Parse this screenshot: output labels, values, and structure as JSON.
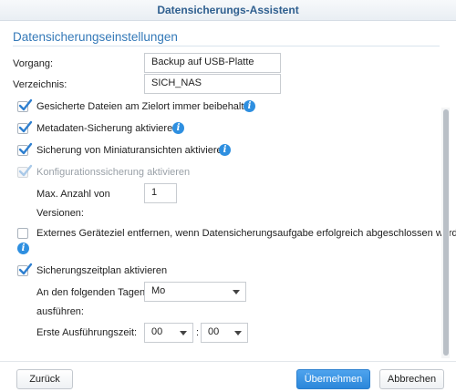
{
  "window": {
    "title": "Datensicherungs-Assistent"
  },
  "section": {
    "title": "Datensicherungseinstellungen"
  },
  "fields": {
    "vorgang_label": "Vorgang:",
    "vorgang_value": "Backup auf USB-Platte",
    "verzeichnis_label": "Verzeichnis:",
    "verzeichnis_value": "SICH_NAS"
  },
  "options": [
    {
      "label": "Gesicherte Dateien am Zielort immer beibehalten",
      "checked": true,
      "info": true
    },
    {
      "label": "Metadaten-Sicherung aktivieren",
      "checked": true,
      "info": true
    },
    {
      "label": "Sicherung von Miniaturansichten aktivieren",
      "checked": true,
      "info": true
    },
    {
      "label": "Konfigurationssicherung aktivieren",
      "checked": true,
      "disabled": true
    },
    {
      "label": "Externes Geräteziel entfernen, wenn Datensicherungsaufgabe erfolgreich abgeschlossen wurde.",
      "checked": false,
      "info": true
    },
    {
      "label": "Sicherungszeitplan aktivieren",
      "checked": true
    }
  ],
  "versions": {
    "label_line1": "Max. Anzahl von",
    "label_line2": "Versionen:",
    "value": "1"
  },
  "schedule": {
    "days_label_line1": "An den folgenden Tagen",
    "days_label_line2": "ausführen:",
    "days_value": "Mo",
    "time_label": "Erste Ausführungszeit:",
    "hour_value": "00",
    "separator": ":",
    "minute_value": "00"
  },
  "buttons": {
    "back": "Zurück",
    "apply": "Übernehmen",
    "cancel": "Abbrechen"
  },
  "colors": {
    "accent": "#3479b8",
    "primary_button": "#2b87da",
    "info_icon": "#2e8fe0"
  }
}
